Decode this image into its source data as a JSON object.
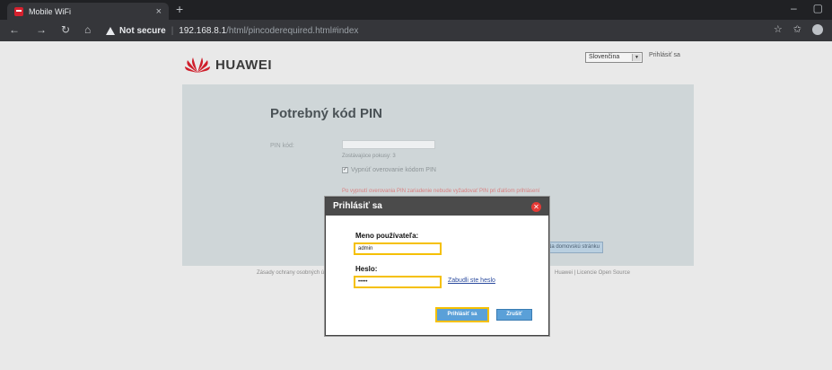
{
  "browser": {
    "tab_title": "Mobile WiFi",
    "tab_close": "×",
    "new_tab": "+",
    "security_label": "Not secure",
    "url_host": "192.168.8.1",
    "url_path": "/html/pincoderequired.html#index",
    "icons": [
      "back-icon",
      "forward-icon",
      "reload-icon",
      "home-icon",
      "warning-icon",
      "star-icon",
      "collections-icon",
      "profile-icon"
    ]
  },
  "header": {
    "logo_text": "HUAWEI",
    "language": "Slovenčina",
    "login_link": "Prihlásiť sa"
  },
  "pin_panel": {
    "title": "Potrebný kód PIN",
    "pin_label": "PIN kód:",
    "attempts": "Zostávajúce pokusy: 3",
    "disable_pin": "Vypnúť overovanie kódom PIN",
    "warning": "Po vypnutí overovania PIN zariadenie nebude vyžadovať PIN pri ďalšom prihlásení",
    "next_button": "Na domovskú stránku"
  },
  "footer": {
    "left": "Zásady ochrany osobných údajov",
    "right": "Huawei | Licencie Open Source"
  },
  "modal": {
    "title": "Prihlásiť sa",
    "username_label": "Meno používateľa:",
    "username_value": "admin",
    "password_label": "Heslo:",
    "password_value": "•••••",
    "forgot_link": "Zabudli ste heslo",
    "login_button": "Prihlásiť sa",
    "cancel_button": "Zrušiť",
    "highlight_color": "#f5c000"
  }
}
